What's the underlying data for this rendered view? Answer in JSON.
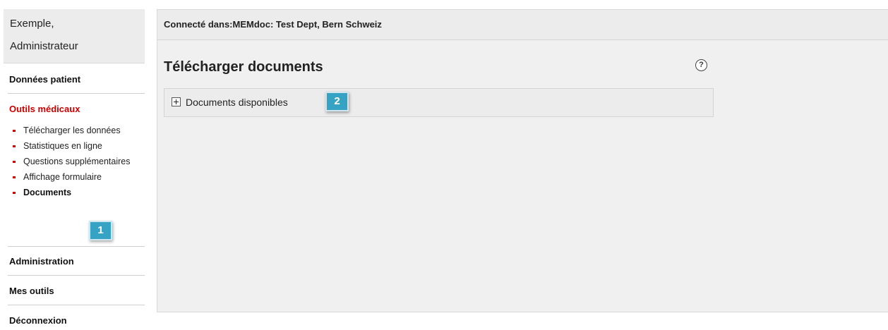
{
  "sidebar": {
    "user_line1": "Exemple,",
    "user_line2": "Administrateur",
    "sections": {
      "patient_data": "Données patient",
      "medical_tools": "Outils médicaux",
      "administration": "Administration",
      "my_tools": "Mes outils",
      "logout": "Déconnexion"
    },
    "medical_tools_items": [
      "Télécharger les données",
      "Statistiques en ligne",
      "Questions supplémentaires",
      "Affichage formulaire",
      "Documents"
    ],
    "selected_item": "Documents"
  },
  "callouts": [
    "1",
    "2"
  ],
  "main": {
    "connection_text": "Connecté dans:MEMdoc: Test Dept, Bern Schweiz",
    "title": "Télécharger documents",
    "help_glyph": "?",
    "accordion_label": "Documents disponibles",
    "accordion_state": "collapsed"
  },
  "colors": {
    "accent_red": "#cc0000",
    "callout_blue": "#37a3c4",
    "panel_bg": "#f0f0f0"
  },
  "icons": [
    "help-circle-icon",
    "expand-plus-icon",
    "bullet-icon"
  ]
}
